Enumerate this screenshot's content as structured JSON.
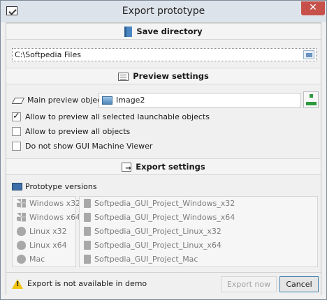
{
  "window": {
    "title": "Export prototype",
    "close_glyph": "✕"
  },
  "save_directory": {
    "header": "Save directory",
    "icon": "book-icon",
    "path_value": "C:\\Softpedia Files"
  },
  "preview_settings": {
    "header": "Preview settings",
    "icon": "preview-settings-icon",
    "main_preview_label": "Main preview object:",
    "main_preview_value": "Image2",
    "checkboxes": [
      {
        "label": "Allow to preview all selected launchable objects",
        "checked": true
      },
      {
        "label": "Allow to preview all objects",
        "checked": false
      },
      {
        "label": "Do not show GUI Machine Viewer",
        "checked": false
      }
    ]
  },
  "export_settings": {
    "header": "Export settings",
    "icon": "export-settings-icon",
    "versions_label": "Prototype versions",
    "platforms": [
      {
        "label": "Windows x32",
        "icon": "windows-icon"
      },
      {
        "label": "Windows x64",
        "icon": "windows-icon"
      },
      {
        "label": "Linux x32",
        "icon": "linux-icon"
      },
      {
        "label": "Linux x64",
        "icon": "linux-icon"
      },
      {
        "label": "Mac",
        "icon": "apple-icon"
      }
    ],
    "projects": [
      "Softpedia_GUI_Project_Windows_x32",
      "Softpedia_GUI_Project_Windows_x64",
      "Softpedia_GUI_Project_Linux_x32",
      "Softpedia_GUI_Project_Linux_x64",
      "Softpedia_GUI_Project_Mac"
    ]
  },
  "footer": {
    "warning": "Export is not available in demo",
    "export_button": "Export now",
    "cancel_button": "Cancel"
  },
  "colors": {
    "accent": "#3c7fb1",
    "close": "#c7504a",
    "warning": "#f1c40f"
  }
}
